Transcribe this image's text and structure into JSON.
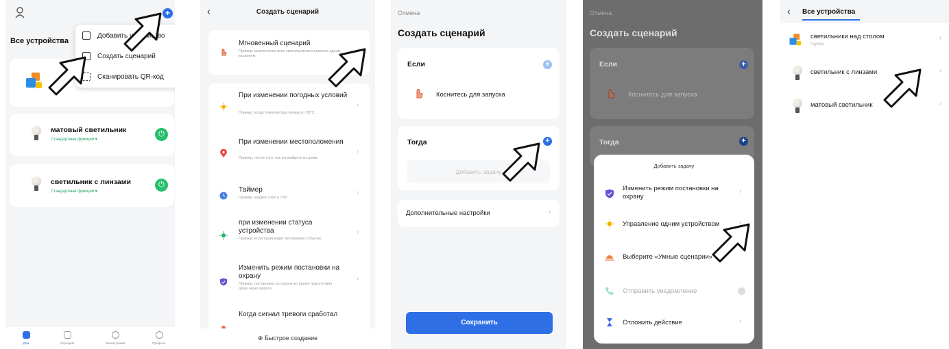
{
  "panel1": {
    "title": "Все устройства",
    "plus": "+",
    "popup": {
      "items": [
        "Добавить устройство",
        "Создать сценарий",
        "Сканировать QR-код"
      ]
    },
    "devices": [
      {
        "name": "матовый светильник",
        "sub": "Стандартные функции ▾"
      },
      {
        "name": "светильник с линзами",
        "sub": "Стандартные функции ▾"
      }
    ],
    "tabs": [
      "Дом",
      "Сценарий",
      "Умный режим",
      "Профиль"
    ]
  },
  "panel2": {
    "back": "‹",
    "title": "Создать сценарий",
    "instant": {
      "title": "Мгновенный сценарий",
      "desc": "Пример: выключение всех светильников в спальне одним касанием."
    },
    "conditions": [
      {
        "title": "При изменении погодных условий",
        "desc": "Пример: когда температура превысит 28°C."
      },
      {
        "title": "При изменении местоположения",
        "desc": "Пример: после того, как вы выйдете из дома."
      },
      {
        "title": "Таймер",
        "desc": "Пример: каждое утро в 7:00."
      },
      {
        "title": "при изменении статуса устройства",
        "desc": "Пример: если происходит нетипичное событие."
      },
      {
        "title": "Изменить режим постановки на охрану",
        "desc": "Пример: постановка на охрану во время присутствия дома через ворота"
      },
      {
        "title": "Когда сигнал тревоги сработал",
        "desc": ""
      }
    ],
    "chevron": "›",
    "footer": "⊕ Быстрое создание"
  },
  "panel3": {
    "cancel": "Отмена",
    "title": "Создать сценарий",
    "if_label": "Если",
    "touch": "Коснитесь для запуска",
    "then_label": "Тогда",
    "add_task": "Добавить задачу",
    "more": "Дополнительные настройки",
    "chevron": "›",
    "save": "Сохранить",
    "plus": "+"
  },
  "panel4": {
    "cancel": "Отмена",
    "title": "Создать сценарий",
    "if_label": "Если",
    "touch": "Коснитесь для запуска",
    "then_label": "Тогда",
    "plus": "+",
    "sheet_title": "Добавить задачу",
    "tasks": [
      {
        "title": "Изменить режим постановки на охрану"
      },
      {
        "title": "Управление одним устройством"
      },
      {
        "title": "Выберите «Умные сценарии»"
      },
      {
        "title": "Отправить уведомление"
      },
      {
        "title": "Отложить действие"
      }
    ],
    "chevron": "›"
  },
  "panel5": {
    "back": "‹",
    "tab": "Все устройства",
    "rows": [
      {
        "title": "светильники над столом",
        "sub": "Группа"
      },
      {
        "title": "светильник с линзами",
        "sub": ""
      },
      {
        "title": "матовый светильник",
        "sub": ""
      }
    ],
    "chevron": "›"
  },
  "colors": {
    "accent": "#2e6fe6",
    "power": "#26c06a"
  }
}
